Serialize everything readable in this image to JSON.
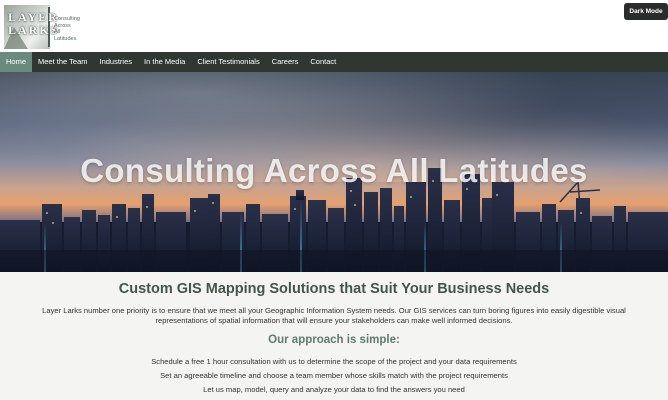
{
  "logo": {
    "mark_text_line1": "LAYER",
    "mark_text_line2": "LARKS",
    "tagline": [
      "Consulting",
      "Across",
      "All",
      "Latitudes"
    ]
  },
  "header": {
    "dark_mode_label": "Dark Mode"
  },
  "nav": {
    "items": [
      {
        "label": "Home",
        "active": true
      },
      {
        "label": "Meet the Team"
      },
      {
        "label": "Industries"
      },
      {
        "label": "In the Media"
      },
      {
        "label": "Client Testimonials"
      },
      {
        "label": "Careers"
      },
      {
        "label": "Contact"
      }
    ]
  },
  "hero": {
    "title": "Consulting Across All Latitudes"
  },
  "main": {
    "heading": "Custom GIS Mapping Solutions that Suit Your Business Needs",
    "intro": "Layer Larks number one priority is to ensure that we meet all your Geographic Information System needs. Our GIS services can turn boring figures into easily digestible visual representations of spatial information that will ensure your stakeholders can make well informed decisions.",
    "approach_heading": "Our approach is simple:",
    "steps": [
      "Schedule a free 1 hour consultation with us to determine the scope of the project and your data requirements",
      "Set an agreeable timeline and choose a team member whose skills match with the project requirements",
      "Let us map, model, query and analyze your data to find the answers you need"
    ]
  },
  "colors": {
    "nav_bg": "#303733",
    "nav_active": "#6a8a7e",
    "heading": "#46544b",
    "accent": "#5e7c70",
    "button_bg": "#2b2d2c"
  }
}
